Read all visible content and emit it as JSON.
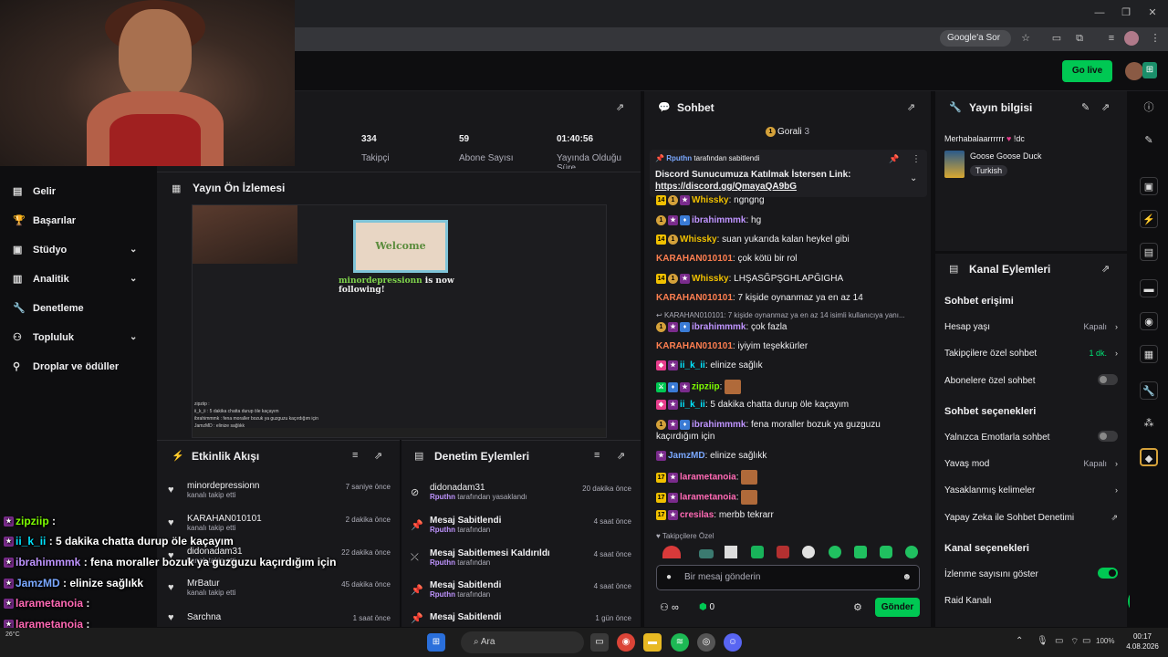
{
  "browser": {
    "google_label": "Google'a Sor",
    "minimize": "—",
    "maximize": "❐",
    "close": "✕"
  },
  "topbar": {
    "go_live": "Go live"
  },
  "sidebar": {
    "items": [
      {
        "label": "Gelir",
        "icon": "revenue-icon"
      },
      {
        "label": "Başarılar",
        "icon": "trophy-icon"
      },
      {
        "label": "Stüdyo",
        "icon": "studio-icon"
      },
      {
        "label": "Analitik",
        "icon": "analytics-icon"
      },
      {
        "label": "Denetleme",
        "icon": "wrench-icon"
      },
      {
        "label": "Topluluk",
        "icon": "community-icon"
      },
      {
        "label": "Droplar ve ödüller",
        "icon": "drops-icon"
      }
    ]
  },
  "stats": {
    "followers_value": "334",
    "followers_label": "Takipçi",
    "subs_value": "59",
    "subs_label": "Abone Sayısı",
    "uptime_value": "01:40:56",
    "uptime_label": "Yayında Olduğu Süre"
  },
  "preview": {
    "title": "Yayın Ön İzlemesi",
    "welcome": "Welcome",
    "follow_name": "minordepressionn",
    "follow_text": " is now following!",
    "mini_chat": [
      "zipziip :",
      "ii_k_ii : 5 dakika chatta durup öle kaçayım",
      "ibrahimmmk : fena moraller bozuk ya guzguzu kaçırdığım için",
      "JamzMD : elinize sağlıkk",
      "larametanoia :",
      "cresilas : merbb tekrarr"
    ]
  },
  "activity": {
    "title": "Etkinlik Akışı",
    "events": [
      {
        "name": "minordepressionn",
        "sub": "kanalı takip etti",
        "time": "7 saniye önce"
      },
      {
        "name": "KARAHAN010101",
        "sub": "kanalı takip etti",
        "time": "2 dakika önce"
      },
      {
        "name": "didonadam31",
        "sub": "kanalı takip etti",
        "time": "22 dakika önce"
      },
      {
        "name": "MrBatur",
        "sub": "kanalı takip etti",
        "time": "45 dakika önce"
      },
      {
        "name": "Sarchna",
        "sub": "",
        "time": "1 saat önce"
      }
    ]
  },
  "modlog": {
    "title": "Denetim Eylemleri",
    "items": [
      {
        "title": "didonadam31",
        "by": "Rputhn",
        "sub": " tarafından yasaklandı",
        "time": "20 dakika önce"
      },
      {
        "title": "Mesaj Sabitlendi",
        "by": "Rputhn",
        "sub": " tarafından",
        "time": "4 saat önce"
      },
      {
        "title": "Mesaj Sabitlemesi Kaldırıldı",
        "by": "Rputhn",
        "sub": " tarafından",
        "time": "4 saat önce"
      },
      {
        "title": "Mesaj Sabitlendi",
        "by": "Rputhn",
        "sub": " tarafından",
        "time": "4 saat önce"
      },
      {
        "title": "Mesaj Sabitlendi",
        "by": "",
        "sub": "",
        "time": "1 gün önce"
      }
    ]
  },
  "chat": {
    "title": "Sohbet",
    "leader": "Gorali",
    "leader_count": "3",
    "pinned_by": "Rputhn",
    "pinned_by_suffix": " tarafından sabitlendi",
    "pinned_text": "Discord Sunucumuza Katılmak İstersen Link:",
    "pinned_link": "https://discord.gg/QmayaQA9bG",
    "messages": [
      {
        "user": "Whissky",
        "color": "#f0c000",
        "text": "ngngng",
        "badges": [
          "14",
          "coin",
          "star"
        ]
      },
      {
        "user": "ibrahimmmk",
        "color": "#bf94ff",
        "text": "hg",
        "badges": [
          "coin",
          "star",
          "prime"
        ]
      },
      {
        "user": "Whissky",
        "color": "#f0c000",
        "text": "suan yukarıda kalan heykel gibi",
        "badges": [
          "14",
          "coin"
        ]
      },
      {
        "user": "KARAHAN010101",
        "color": "#ff7f50",
        "text": "çok kötü bir rol",
        "badges": []
      },
      {
        "user": "Whissky",
        "color": "#f0c000",
        "text": "LHŞASĞPŞGHLAPĞIGHA",
        "badges": [
          "14",
          "coin",
          "star"
        ]
      },
      {
        "user": "KARAHAN010101",
        "color": "#ff7f50",
        "text": "7 kişide oynanmaz ya en az 14",
        "badges": []
      },
      {
        "user": "ibrahimmmk",
        "color": "#bf94ff",
        "text": "çok fazla",
        "badges": [
          "coin",
          "star",
          "prime"
        ]
      },
      {
        "user": "KARAHAN010101",
        "color": "#ff7f50",
        "text": "iyiyim teşekkürler",
        "badges": []
      },
      {
        "user": "ii_k_ii",
        "color": "#00e5ff",
        "text": "elinize sağlık",
        "badges": [
          "vip",
          "star"
        ]
      },
      {
        "user": "zipziip",
        "color": "#7fff00",
        "text": "",
        "badges": [
          "mod",
          "prime",
          "star"
        ]
      },
      {
        "user": "ii_k_ii",
        "color": "#00e5ff",
        "text": "5 dakika chatta durup öle kaçayım",
        "badges": [
          "vip",
          "star"
        ]
      },
      {
        "user": "ibrahimmmk",
        "color": "#bf94ff",
        "text": "fena moraller bozuk ya guzguzu kaçırdığım için",
        "badges": [
          "coin",
          "star",
          "prime"
        ]
      },
      {
        "user": "JamzMD",
        "color": "#7aa8ff",
        "text": "elinize sağlıkk",
        "badges": [
          "star"
        ]
      },
      {
        "user": "larametanoia",
        "color": "#ff69b4",
        "text": "",
        "badges": [
          "17",
          "star"
        ]
      },
      {
        "user": "larametanoia",
        "color": "#ff69b4",
        "text": "",
        "badges": [
          "17",
          "star"
        ]
      },
      {
        "user": "cresilas",
        "color": "#ff69b4",
        "text": "merbb tekrarr",
        "badges": [
          "17",
          "star"
        ]
      }
    ],
    "reply_preview": "KARAHAN010101: 7 kişide oynanmaz ya en az 14 isimli kullanıcıya yanı...",
    "followers_only": "Takipçilere Özel",
    "input_placeholder": "Bir mesaj gönderin",
    "viewers": "∞",
    "points": "0",
    "send": "Gönder"
  },
  "streaminfo": {
    "title": "Yayın bilgisi",
    "stream_title": "Merhabalaarrrrrr",
    "stream_title_suffix": "!dc",
    "game": "Goose Goose Duck",
    "tag": "Turkish"
  },
  "channel": {
    "title": "Kanal Eylemleri",
    "sec_access": "Sohbet erişimi",
    "account_age": "Hesap yaşı",
    "account_age_val": "Kapalı",
    "followers_chat": "Takipçilere özel sohbet",
    "followers_chat_val": "1 dk.",
    "subs_chat": "Abonelere özel sohbet",
    "sec_options": "Sohbet seçenekleri",
    "emote_only": "Yalnızca Emotlarla sohbet",
    "slow_mode": "Yavaş mod",
    "slow_mode_val": "Kapalı",
    "banned_words": "Yasaklanmış kelimeler",
    "ai_mod": "Yapay Zeka ile Sohbet Denetimi",
    "sec_channel": "Kanal seçenekleri",
    "viewer_count": "İzlenme sayısını göster",
    "raid": "Raid Kanalı"
  },
  "overlay": {
    "lines": [
      {
        "user": "zipziip",
        "text": " : ",
        "color": "#7fff00"
      },
      {
        "user": "ii_k_ii",
        "text": " : 5 dakika chatta durup öle kaçayım",
        "color": "#00e5ff"
      },
      {
        "user": "ibrahimmmk",
        "text": " : fena moraller bozuk ya guzguzu kaçırdığım için",
        "color": "#bf94ff"
      },
      {
        "user": "JamzMD",
        "text": " : elinize sağlıkk",
        "color": "#7aa8ff"
      },
      {
        "user": "larametanoia",
        "text": " : ",
        "color": "#ff69b4"
      },
      {
        "user": "larametanoia",
        "text": " : ",
        "color": "#ff69b4"
      },
      {
        "user": "cresilas",
        "text": " : merbb tekrarr",
        "color": "#ffffff"
      }
    ],
    "weather": "26°C"
  },
  "taskbar": {
    "search": "Ara",
    "time": "00:17",
    "date": "4.08.2026",
    "battery": "100%"
  }
}
